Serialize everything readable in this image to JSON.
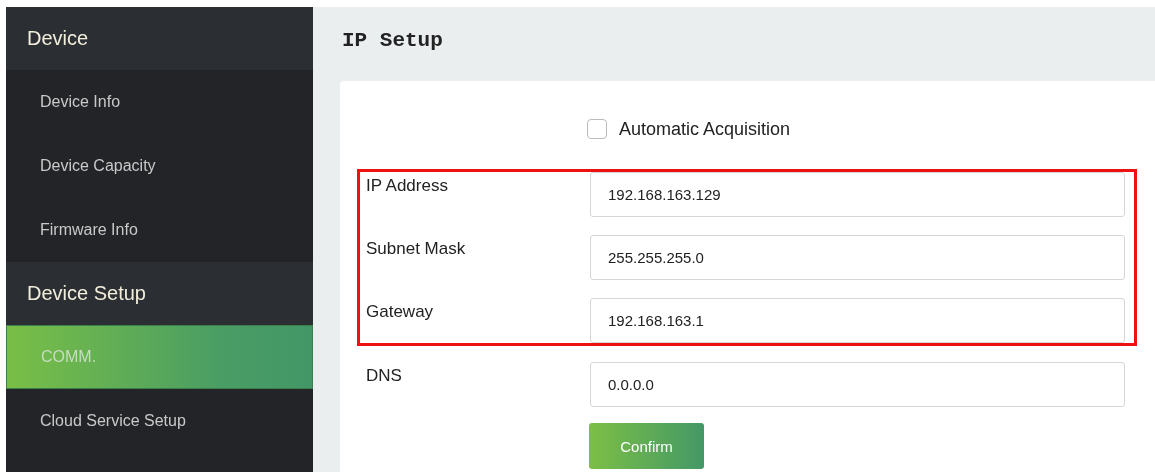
{
  "sidebar": {
    "sections": [
      {
        "title": "Device",
        "items": [
          {
            "label": "Device Info",
            "selected": false
          },
          {
            "label": "Device Capacity",
            "selected": false
          },
          {
            "label": "Firmware Info",
            "selected": false
          }
        ]
      },
      {
        "title": "Device Setup",
        "items": [
          {
            "label": "COMM.",
            "selected": true
          },
          {
            "label": "Cloud Service Setup",
            "selected": false
          }
        ]
      }
    ]
  },
  "page": {
    "title": "IP Setup",
    "auto_acquisition": {
      "label": "Automatic Acquisition",
      "checked": false
    },
    "fields": [
      {
        "label": "IP Address",
        "value": "192.168.163.129",
        "highlighted": true
      },
      {
        "label": "Subnet Mask",
        "value": "255.255.255.0",
        "highlighted": true
      },
      {
        "label": "Gateway",
        "value": "192.168.163.1",
        "highlighted": true
      },
      {
        "label": "DNS",
        "value": "0.0.0.0",
        "highlighted": false
      }
    ],
    "confirm_button": "Confirm"
  }
}
